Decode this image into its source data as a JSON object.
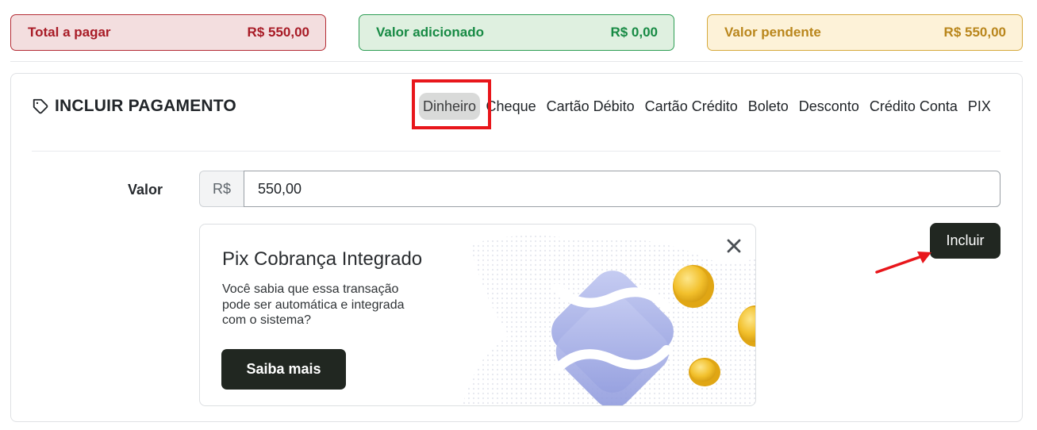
{
  "summary": {
    "total": {
      "label": "Total a pagar",
      "value": "R$ 550,00",
      "bg": "#f3dedf",
      "color": "#a81b26"
    },
    "added": {
      "label": "Valor adicionado",
      "value": "R$ 0,00",
      "bg": "#dff0e0",
      "color": "#178a44"
    },
    "pending": {
      "label": "Valor pendente",
      "value": "R$ 550,00",
      "bg": "#fdf2d8",
      "color": "#b9861c"
    }
  },
  "section": {
    "title": "INCLUIR PAGAMENTO",
    "icon": "tag-icon"
  },
  "tabs": [
    {
      "label": "Dinheiro",
      "active": true
    },
    {
      "label": "Cheque",
      "active": false
    },
    {
      "label": "Cartão Débito",
      "active": false
    },
    {
      "label": "Cartão Crédito",
      "active": false
    },
    {
      "label": "Boleto",
      "active": false
    },
    {
      "label": "Desconto",
      "active": false
    },
    {
      "label": "Crédito Conta",
      "active": false
    },
    {
      "label": "PIX",
      "active": false
    }
  ],
  "form": {
    "valor_label": "Valor",
    "currency_prefix": "R$",
    "valor_value": "550,00"
  },
  "actions": {
    "incluir_label": "Incluir"
  },
  "promo": {
    "title": "Pix Cobrança Integrado",
    "text": "Você sabia que essa transação pode ser automática e integrada com o sistema?",
    "button_label": "Saiba mais",
    "close_icon": "close-icon",
    "art_icon": "pix-logo-icon"
  },
  "colors": {
    "dark_button": "#212721",
    "highlight": "#e8161b",
    "pix_purple": "#9aa3e0",
    "coin_gold": "#f2c02c"
  }
}
